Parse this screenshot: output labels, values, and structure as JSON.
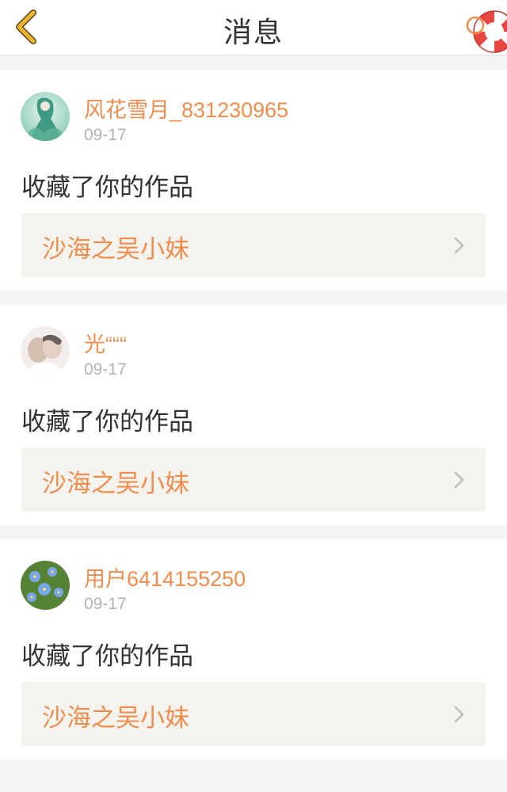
{
  "header": {
    "title": "消息",
    "back_icon": "chevron-left-icon",
    "help_icon": "lifebuoy-icon"
  },
  "colors": {
    "accent": "#ef8d4f",
    "back_icon": "#f0b530",
    "card_link_bg": "#f4f3ee",
    "page_bg": "#f3f3f3"
  },
  "messages": [
    {
      "user": "风花雪月_831230965",
      "date": "09-17",
      "action": "收藏了你的作品",
      "work_title": "沙海之吴小妹",
      "avatar": "avatar-green-figure"
    },
    {
      "user": "光“““",
      "date": "09-17",
      "action": "收藏了你的作品",
      "work_title": "沙海之吴小妹",
      "avatar": "avatar-couple-photo"
    },
    {
      "user": "用户6414155250",
      "date": "09-17",
      "action": "收藏了你的作品",
      "work_title": "沙海之吴小妹",
      "avatar": "avatar-blue-flowers"
    }
  ]
}
